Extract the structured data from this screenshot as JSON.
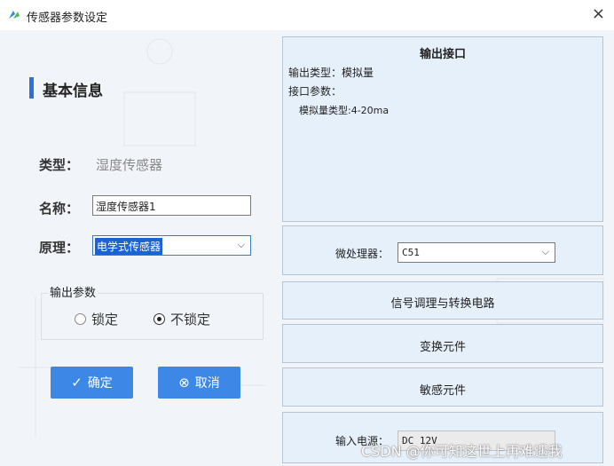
{
  "window": {
    "title": "传感器参数设定",
    "close_glyph": "×"
  },
  "basic_info": {
    "section_title": "基本信息",
    "type_label": "类型：",
    "type_value": "湿度传感器",
    "name_label": "名称：",
    "name_value": "湿度传感器1",
    "principle_label": "原理：",
    "principle_value": "电学式传感器"
  },
  "output_params": {
    "legend": "输出参数",
    "options": [
      {
        "label": "锁定",
        "selected": false
      },
      {
        "label": "不锁定",
        "selected": true
      }
    ]
  },
  "buttons": {
    "confirm": "确定",
    "cancel": "取消"
  },
  "output_interface": {
    "title": "输出接口",
    "output_type": "输出类型：模拟量",
    "interface_params": "接口参数：",
    "analog_type": "模拟量类型:4-20ma"
  },
  "processor": {
    "label": "微处理器：",
    "value": "C51"
  },
  "signal_block": {
    "label": "信号调理与转换电路"
  },
  "transform_block": {
    "label": "变换元件"
  },
  "sensing_block": {
    "label": "敏感元件"
  },
  "power": {
    "label": "输入电源：",
    "value": "DC 12V"
  },
  "watermark": "CSDN @你可知这世上再难遇我",
  "colors": {
    "accent": "#3d88e6",
    "panel_bg": "#e6f0fb",
    "section_bar": "#2f6fd8"
  }
}
